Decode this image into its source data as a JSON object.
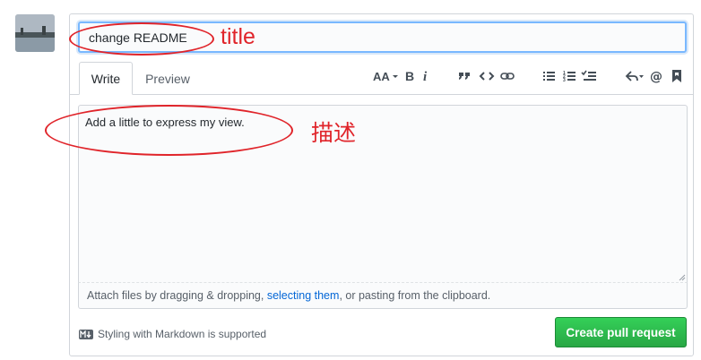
{
  "title_field": {
    "value": "change README"
  },
  "tabs": [
    {
      "label": "Write",
      "active": true
    },
    {
      "label": "Preview",
      "active": false
    }
  ],
  "toolbar": {
    "icons": [
      "text-size-icon",
      "bold-icon",
      "italic-icon",
      "quote-icon",
      "code-icon",
      "link-icon",
      "bulleted-list-icon",
      "numbered-list-icon",
      "task-list-icon",
      "reply-icon",
      "mention-icon",
      "saved-reply-icon"
    ]
  },
  "body_field": {
    "value": "Add a little to express my view."
  },
  "attach": {
    "prefix": "Attach files by dragging & dropping, ",
    "link": "selecting them",
    "suffix": ", or pasting from the clipboard."
  },
  "markdown_note": "Styling with Markdown is supported",
  "submit_label": "Create pull request",
  "annotations": {
    "title_label": "title",
    "body_label": "描述",
    "color": "#e0242a"
  },
  "colors": {
    "primary_button": "#28a745",
    "link": "#0366d6",
    "focus_border": "#79b8ff"
  }
}
